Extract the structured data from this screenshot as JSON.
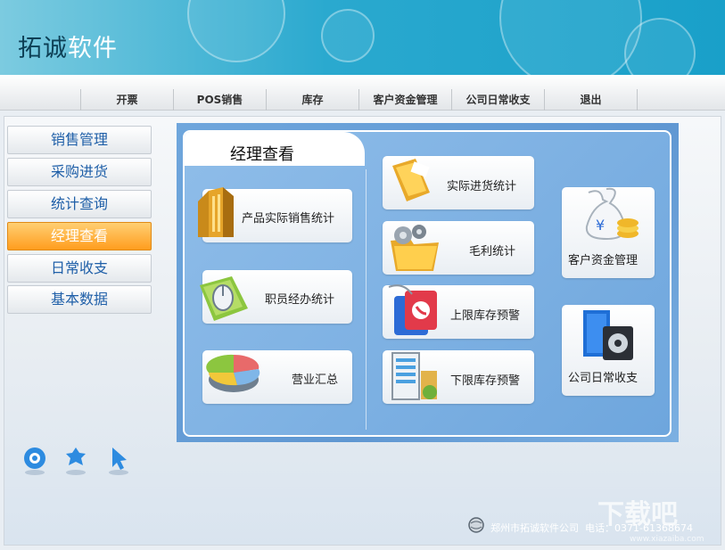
{
  "brand": {
    "part1": "拓诚",
    "part2": "软件"
  },
  "nav": [
    "开票",
    "POS销售",
    "库存",
    "客户资金管理",
    "公司日常收支",
    "退出"
  ],
  "sidebar": {
    "items": [
      {
        "label": "销售管理"
      },
      {
        "label": "采购进货"
      },
      {
        "label": "统计查询"
      },
      {
        "label": "经理查看",
        "active": true
      },
      {
        "label": "日常收支"
      },
      {
        "label": "基本数据"
      }
    ]
  },
  "panel": {
    "title": "经理查看",
    "left_cards": [
      "产品实际销售统计",
      "职员经办统计",
      "营业汇总"
    ],
    "mid_cards": [
      "实际进货统计",
      "毛利统计",
      "上限库存预警",
      "下限库存预警"
    ],
    "right_cards": [
      "客户资金管理",
      "公司日常收支"
    ]
  },
  "footer": {
    "company": "郑州市拓诚软件公司",
    "phone": "电话：0371-61368674",
    "watermark": "下载吧",
    "watermark_url": "www.xiazaiba.com"
  },
  "colors": {
    "header": "#19a0c9",
    "active": "#ff9d1e",
    "panel": "#5f97d2",
    "sidebar_text": "#1f5fa8"
  }
}
